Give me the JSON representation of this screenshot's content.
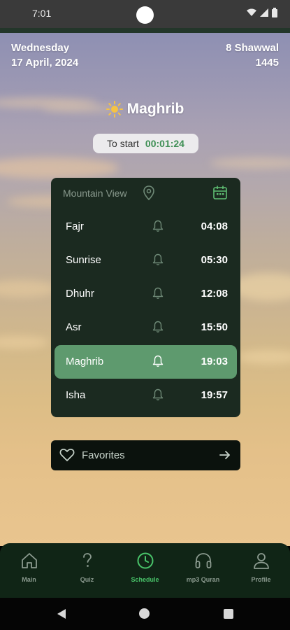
{
  "status_bar": {
    "time": "7:01",
    "icons": [
      "wifi-icon",
      "signal-icon",
      "battery-icon"
    ]
  },
  "header": {
    "weekday": "Wednesday",
    "gregorian_date": "17 April, 2024",
    "hijri_day_month": "8 Shawwal",
    "hijri_year": "1445"
  },
  "current_prayer": {
    "icon": "sun-icon",
    "name": "Maghrib",
    "countdown_label": "To start",
    "countdown_value": "00:01:24"
  },
  "schedule": {
    "location": "Mountain View",
    "location_icon": "location-pin-icon",
    "calendar_icon": "calendar-icon",
    "prayers": [
      {
        "name": "Fajr",
        "time": "04:08",
        "active": false
      },
      {
        "name": "Sunrise",
        "time": "05:30",
        "active": false
      },
      {
        "name": "Dhuhr",
        "time": "12:08",
        "active": false
      },
      {
        "name": "Asr",
        "time": "15:50",
        "active": false
      },
      {
        "name": "Maghrib",
        "time": "19:03",
        "active": true
      },
      {
        "name": "Isha",
        "time": "19:57",
        "active": false
      }
    ]
  },
  "favorites": {
    "label": "Favorites",
    "icon": "heart-icon",
    "arrow_icon": "arrow-right-icon"
  },
  "bottom_nav": {
    "items": [
      {
        "label": "Main",
        "icon": "home-icon",
        "active": false
      },
      {
        "label": "Quiz",
        "icon": "question-icon",
        "active": false
      },
      {
        "label": "Schedule",
        "icon": "clock-icon",
        "active": true
      },
      {
        "label": "mp3 Quran",
        "icon": "headphones-icon",
        "active": false
      },
      {
        "label": "Profile",
        "icon": "person-icon",
        "active": false
      }
    ]
  },
  "colors": {
    "accent_green": "#49c46a",
    "active_row": "#5e9a6e",
    "card_bg": "#1b2a20",
    "nav_bg": "#102516"
  }
}
